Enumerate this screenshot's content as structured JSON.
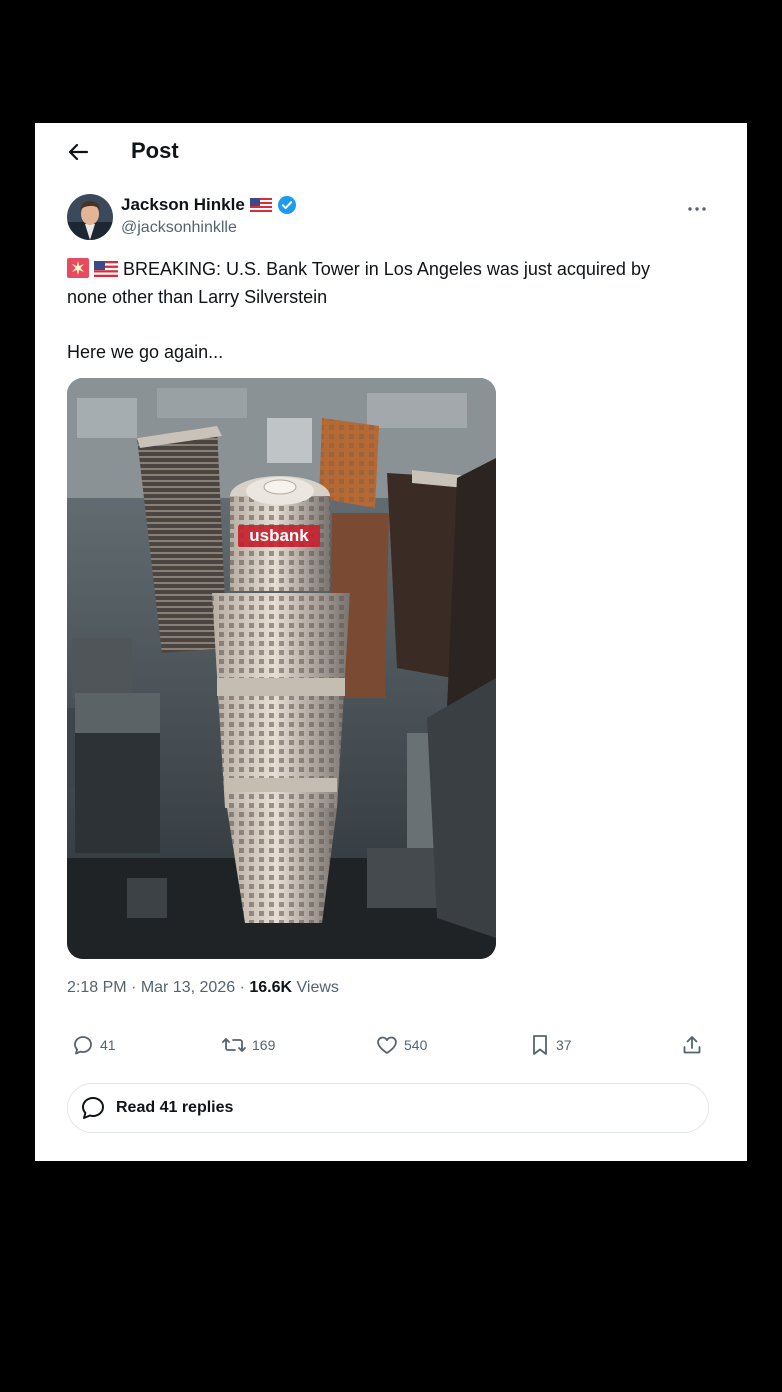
{
  "header": {
    "title": "Post"
  },
  "post": {
    "author": {
      "name": "Jackson Hinkle",
      "handle": "@jacksonhinklle"
    },
    "text_line1": "BREAKING: U.S. Bank Tower in Los Angeles was just acquired by",
    "text_line2": "none other than Larry Silverstein",
    "text_line3": "Here we go again...",
    "image_sign_text": "usbank",
    "time": "2:18 PM",
    "date": "Mar 13, 2026",
    "views_count": "16.6K",
    "views_label": "Views",
    "replies": "41",
    "reposts": "169",
    "likes": "540",
    "bookmarks": "37"
  },
  "footer": {
    "read_replies_label": "Read 41 replies"
  },
  "colors": {
    "verified": "#1d9bf0",
    "muted": "#536471",
    "text": "#0f1419"
  }
}
